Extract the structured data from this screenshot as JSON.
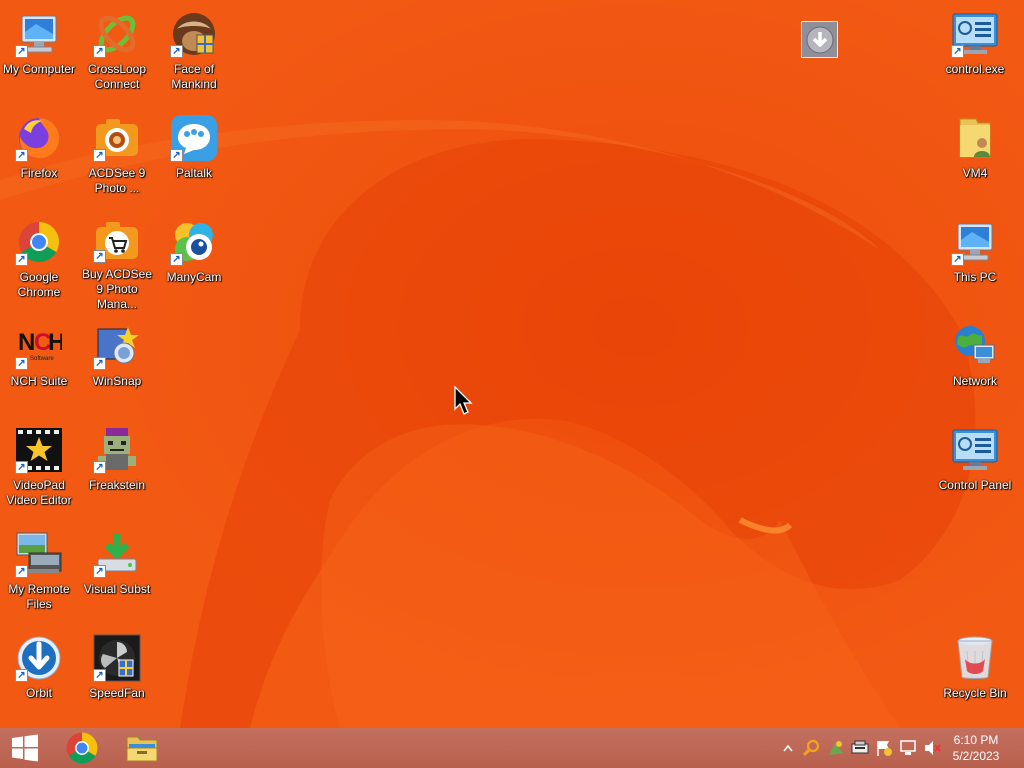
{
  "desktop": {
    "icons_left": [
      {
        "label": "My Computer",
        "icon": "my-computer-icon"
      },
      {
        "label": "CrossLoop Connect",
        "icon": "crossloop-icon"
      },
      {
        "label": "Face of Mankind",
        "icon": "face-of-mankind-icon"
      },
      {
        "label": "Firefox",
        "icon": "firefox-icon"
      },
      {
        "label": "ACDSee 9 Photo ...",
        "icon": "acdsee-icon"
      },
      {
        "label": "Paltalk",
        "icon": "paltalk-icon"
      },
      {
        "label": "Google Chrome",
        "icon": "chrome-icon"
      },
      {
        "label": "Buy ACDSee 9 Photo Mana...",
        "icon": "buy-acdsee-icon"
      },
      {
        "label": "ManyCam",
        "icon": "manycam-icon"
      },
      {
        "label": "NCH Suite",
        "icon": "nch-suite-icon"
      },
      {
        "label": "WinSnap",
        "icon": "winsnap-icon"
      },
      {
        "label": "VideoPad Video Editor",
        "icon": "videopad-icon"
      },
      {
        "label": "Freakstein",
        "icon": "freakstein-icon"
      },
      {
        "label": "My Remote Files",
        "icon": "remote-files-icon"
      },
      {
        "label": "Visual Subst",
        "icon": "visual-subst-icon"
      },
      {
        "label": "Orbit",
        "icon": "orbit-icon"
      },
      {
        "label": "SpeedFan",
        "icon": "speedfan-icon"
      }
    ],
    "icons_right": [
      {
        "label": "control.exe",
        "icon": "control-exe-icon"
      },
      {
        "label": "VM4",
        "icon": "folder-icon"
      },
      {
        "label": "This PC",
        "icon": "this-pc-icon"
      },
      {
        "label": "Network",
        "icon": "network-icon"
      },
      {
        "label": "Control Panel",
        "icon": "control-panel-icon"
      },
      {
        "label": "Recycle Bin",
        "icon": "recycle-bin-icon"
      }
    ],
    "floating_widget": {
      "icon": "download-arrow-icon"
    }
  },
  "taskbar": {
    "start": "windows-start-icon",
    "pinned": [
      "chrome-icon",
      "file-explorer-icon"
    ],
    "tray": [
      "show-hidden-icons-chevron",
      "search-tray-icon",
      "app-tray-icon",
      "device-tray-icon",
      "action-center-flag-icon",
      "network-tray-icon",
      "volume-muted-icon"
    ],
    "clock": {
      "time": "6:10 PM",
      "date": "5/2/2023"
    }
  },
  "colors": {
    "wallpaper": "#f04a0c",
    "taskbar": "#bd6553"
  }
}
